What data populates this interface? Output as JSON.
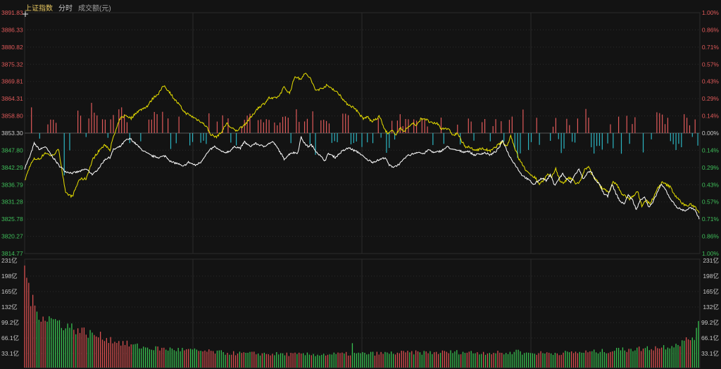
{
  "header": {
    "index_name": "上证指数",
    "view_mode": "分时",
    "volume_label": "成交额(元)"
  },
  "colors": {
    "background": "#131313",
    "grid": "#2b2b2b",
    "up": "#e05a5a",
    "down": "#2cb5c2",
    "price_line": "#ffffff",
    "avg_line": "#e8e000",
    "vol_up": "#d85050",
    "vol_down": "#38c050",
    "label_text": "#c8c8c8"
  },
  "chart_data": [
    {
      "type": "line",
      "ylim": [
        3814.77,
        3891.83
      ],
      "base": 3853.3,
      "y_ticks_left": [
        "3891.83",
        "3886.33",
        "3880.82",
        "3875.32",
        "3869.81",
        "3864.31",
        "3858.80",
        "3853.30",
        "3847.80",
        "3842.29",
        "3836.79",
        "3831.28",
        "3825.78",
        "3820.27",
        "3814.77"
      ],
      "y_ticks_right": [
        "1.00%",
        "0.86%",
        "0.71%",
        "0.57%",
        "0.43%",
        "0.29%",
        "0.14%",
        "0.00%",
        "0.14%",
        "0.29%",
        "0.43%",
        "0.57%",
        "0.71%",
        "0.86%",
        "1.00%"
      ],
      "price_keypoints": [
        [
          0,
          3842
        ],
        [
          8,
          3846
        ],
        [
          14,
          3850
        ],
        [
          22,
          3848
        ],
        [
          30,
          3849
        ],
        [
          40,
          3846
        ],
        [
          50,
          3843
        ],
        [
          60,
          3841
        ],
        [
          70,
          3840.5
        ],
        [
          80,
          3841
        ],
        [
          90,
          3841.8
        ],
        [
          100,
          3840
        ],
        [
          110,
          3842.5
        ],
        [
          118,
          3845
        ],
        [
          125,
          3845.5
        ],
        [
          130,
          3848
        ],
        [
          140,
          3849
        ],
        [
          148,
          3851
        ],
        [
          155,
          3851.5
        ],
        [
          162,
          3850
        ],
        [
          170,
          3848.3
        ],
        [
          178,
          3847
        ],
        [
          186,
          3846
        ],
        [
          196,
          3845.5
        ],
        [
          206,
          3846
        ],
        [
          215,
          3844
        ],
        [
          225,
          3843.5
        ],
        [
          232,
          3842.5
        ],
        [
          240,
          3844
        ],
        [
          250,
          3843
        ],
        [
          258,
          3844
        ],
        [
          264,
          3846
        ],
        [
          272,
          3848
        ],
        [
          278,
          3849
        ],
        [
          284,
          3848
        ],
        [
          292,
          3847
        ],
        [
          300,
          3847.5
        ],
        [
          308,
          3849
        ],
        [
          316,
          3848.5
        ],
        [
          322,
          3850.5
        ],
        [
          330,
          3849
        ],
        [
          338,
          3850
        ],
        [
          344,
          3849.5
        ],
        [
          350,
          3849
        ],
        [
          358,
          3850
        ],
        [
          364,
          3850.5
        ],
        [
          372,
          3848
        ],
        [
          380,
          3845
        ],
        [
          390,
          3847
        ],
        [
          400,
          3847
        ],
        [
          405,
          3852
        ],
        [
          410,
          3850
        ],
        [
          415,
          3849
        ],
        [
          420,
          3849.5
        ],
        [
          425,
          3848
        ],
        [
          435,
          3845.5
        ],
        [
          440,
          3844.5
        ],
        [
          445,
          3846.8
        ],
        [
          455,
          3845.5
        ],
        [
          465,
          3847.5
        ],
        [
          475,
          3848.6
        ],
        [
          482,
          3847.8
        ],
        [
          490,
          3847
        ],
        [
          500,
          3845
        ],
        [
          510,
          3844
        ],
        [
          520,
          3844.8
        ],
        [
          528,
          3845.5
        ],
        [
          534,
          3843
        ],
        [
          540,
          3842.5
        ],
        [
          546,
          3843
        ],
        [
          552,
          3844
        ],
        [
          560,
          3846
        ],
        [
          568,
          3846.6
        ],
        [
          576,
          3847.3
        ],
        [
          584,
          3846.6
        ],
        [
          592,
          3848
        ],
        [
          600,
          3847
        ],
        [
          610,
          3847.6
        ],
        [
          620,
          3849
        ],
        [
          626,
          3848
        ],
        [
          634,
          3847.8
        ],
        [
          642,
          3847.3
        ],
        [
          650,
          3847.5
        ],
        [
          658,
          3846.3
        ],
        [
          666,
          3846.6
        ],
        [
          674,
          3847
        ],
        [
          682,
          3846.3
        ],
        [
          690,
          3847.4
        ],
        [
          696,
          3849
        ],
        [
          700,
          3851
        ],
        [
          704,
          3849
        ],
        [
          710,
          3846
        ],
        [
          716,
          3844
        ],
        [
          722,
          3842
        ],
        [
          728,
          3840
        ],
        [
          734,
          3839
        ],
        [
          740,
          3838
        ],
        [
          746,
          3836.8
        ],
        [
          752,
          3838
        ],
        [
          758,
          3839
        ],
        [
          764,
          3838
        ],
        [
          770,
          3840
        ],
        [
          776,
          3836.6
        ],
        [
          782,
          3838.5
        ],
        [
          788,
          3840.3
        ],
        [
          794,
          3838.5
        ],
        [
          800,
          3837.5
        ],
        [
          806,
          3840
        ],
        [
          812,
          3841.8
        ],
        [
          818,
          3838.5
        ],
        [
          824,
          3840.6
        ],
        [
          830,
          3841
        ],
        [
          836,
          3838
        ],
        [
          842,
          3837
        ],
        [
          848,
          3834
        ],
        [
          854,
          3833
        ],
        [
          860,
          3837
        ],
        [
          866,
          3834
        ],
        [
          872,
          3831.5
        ],
        [
          878,
          3830.6
        ],
        [
          884,
          3833.5
        ],
        [
          890,
          3832
        ],
        [
          896,
          3828.8
        ],
        [
          902,
          3832
        ],
        [
          908,
          3833
        ],
        [
          914,
          3829.5
        ],
        [
          920,
          3831
        ],
        [
          926,
          3834
        ],
        [
          932,
          3836.8
        ],
        [
          938,
          3835.5
        ],
        [
          944,
          3833
        ],
        [
          950,
          3831
        ],
        [
          956,
          3829.5
        ],
        [
          962,
          3828.8
        ],
        [
          968,
          3828.5
        ],
        [
          975,
          3829.5
        ],
        [
          982,
          3828.5
        ],
        [
          988,
          3826
        ]
      ],
      "avg_keypoints": [
        [
          0,
          3838
        ],
        [
          8,
          3843
        ],
        [
          14,
          3845
        ],
        [
          22,
          3845
        ],
        [
          30,
          3847
        ],
        [
          40,
          3846
        ],
        [
          50,
          3848
        ],
        [
          60,
          3834
        ],
        [
          70,
          3833
        ],
        [
          80,
          3838.5
        ],
        [
          90,
          3838.7
        ],
        [
          100,
          3845
        ],
        [
          110,
          3848
        ],
        [
          118,
          3849.5
        ],
        [
          125,
          3848
        ],
        [
          130,
          3852
        ],
        [
          140,
          3858
        ],
        [
          148,
          3859
        ],
        [
          156,
          3858
        ],
        [
          164,
          3860
        ],
        [
          172,
          3861
        ],
        [
          180,
          3862
        ],
        [
          188,
          3864.5
        ],
        [
          196,
          3866
        ],
        [
          204,
          3868.5
        ],
        [
          212,
          3866.5
        ],
        [
          220,
          3864
        ],
        [
          226,
          3862.5
        ],
        [
          234,
          3860
        ],
        [
          242,
          3859
        ],
        [
          250,
          3858
        ],
        [
          258,
          3857
        ],
        [
          266,
          3855.5
        ],
        [
          272,
          3853
        ],
        [
          280,
          3852
        ],
        [
          288,
          3853.5
        ],
        [
          296,
          3856.5
        ],
        [
          302,
          3855
        ],
        [
          310,
          3854
        ],
        [
          316,
          3855
        ],
        [
          322,
          3856
        ],
        [
          328,
          3857.5
        ],
        [
          334,
          3859
        ],
        [
          340,
          3861
        ],
        [
          346,
          3862
        ],
        [
          352,
          3863
        ],
        [
          358,
          3864.6
        ],
        [
          364,
          3864.3
        ],
        [
          372,
          3865
        ],
        [
          380,
          3868
        ],
        [
          388,
          3866
        ],
        [
          396,
          3871.5
        ],
        [
          404,
          3870.5
        ],
        [
          410,
          3872.5
        ],
        [
          418,
          3871
        ],
        [
          426,
          3867
        ],
        [
          434,
          3867.5
        ],
        [
          442,
          3868.5
        ],
        [
          450,
          3867.7
        ],
        [
          456,
          3866.6
        ],
        [
          462,
          3865.5
        ],
        [
          470,
          3863
        ],
        [
          478,
          3862
        ],
        [
          484,
          3861.2
        ],
        [
          490,
          3859.5
        ],
        [
          496,
          3857.8
        ],
        [
          502,
          3858.6
        ],
        [
          508,
          3857
        ],
        [
          514,
          3857.6
        ],
        [
          520,
          3858.7
        ],
        [
          526,
          3855
        ],
        [
          532,
          3853
        ],
        [
          538,
          3854
        ],
        [
          544,
          3853
        ],
        [
          550,
          3854.8
        ],
        [
          556,
          3854
        ],
        [
          562,
          3855.2
        ],
        [
          568,
          3856.5
        ],
        [
          574,
          3855.6
        ],
        [
          580,
          3857.8
        ],
        [
          586,
          3858
        ],
        [
          592,
          3857
        ],
        [
          598,
          3856.3
        ],
        [
          604,
          3856.5
        ],
        [
          610,
          3854.7
        ],
        [
          616,
          3855
        ],
        [
          622,
          3854.2
        ],
        [
          628,
          3852.5
        ],
        [
          634,
          3853.3
        ],
        [
          640,
          3850.6
        ],
        [
          646,
          3849
        ],
        [
          652,
          3848.7
        ],
        [
          658,
          3847.8
        ],
        [
          664,
          3848.1
        ],
        [
          670,
          3848.3
        ],
        [
          676,
          3848
        ],
        [
          682,
          3847.5
        ],
        [
          688,
          3848.5
        ],
        [
          694,
          3849.6
        ],
        [
          700,
          3850.5
        ],
        [
          706,
          3849
        ],
        [
          712,
          3852.5
        ],
        [
          718,
          3848.5
        ],
        [
          724,
          3845
        ],
        [
          730,
          3843
        ],
        [
          736,
          3840.7
        ],
        [
          742,
          3840
        ],
        [
          748,
          3839
        ],
        [
          754,
          3837
        ],
        [
          760,
          3838.3
        ],
        [
          766,
          3840
        ],
        [
          772,
          3839.2
        ],
        [
          778,
          3842
        ],
        [
          784,
          3838
        ],
        [
          790,
          3837.3
        ],
        [
          796,
          3839
        ],
        [
          802,
          3838.5
        ],
        [
          808,
          3837
        ],
        [
          814,
          3837.8
        ],
        [
          820,
          3841.5
        ],
        [
          826,
          3842.5
        ],
        [
          832,
          3839.5
        ],
        [
          838,
          3838.3
        ],
        [
          844,
          3836
        ],
        [
          850,
          3835.4
        ],
        [
          856,
          3834
        ],
        [
          862,
          3837.6
        ],
        [
          868,
          3836.6
        ],
        [
          874,
          3834
        ],
        [
          880,
          3833.2
        ],
        [
          886,
          3832
        ],
        [
          892,
          3833.5
        ],
        [
          898,
          3834.5
        ],
        [
          904,
          3830
        ],
        [
          910,
          3831.8
        ],
        [
          916,
          3830.8
        ],
        [
          922,
          3833
        ],
        [
          928,
          3836
        ],
        [
          934,
          3837.5
        ],
        [
          940,
          3836.8
        ],
        [
          946,
          3836
        ],
        [
          952,
          3833.6
        ],
        [
          958,
          3832
        ],
        [
          964,
          3830.7
        ],
        [
          970,
          3830
        ],
        [
          976,
          3830.4
        ],
        [
          982,
          3829.7
        ],
        [
          988,
          3828
        ]
      ],
      "series": [
        {
          "key": "price_keypoints",
          "color": "#ffffff"
        },
        {
          "key": "avg_keypoints",
          "color": "#e8e000"
        }
      ]
    },
    {
      "type": "bar",
      "y_ticks": [
        "231亿",
        "198亿",
        "165亿",
        "132亿",
        "99.2亿",
        "66.1亿",
        "33.1亿"
      ],
      "ylim": [
        0,
        231
      ],
      "volume_keypoints": [
        [
          0,
          231
        ],
        [
          3,
          190
        ],
        [
          6,
          170
        ],
        [
          9,
          150
        ],
        [
          12,
          135
        ],
        [
          15,
          125
        ],
        [
          20,
          118
        ],
        [
          30,
          108
        ],
        [
          40,
          103
        ],
        [
          50,
          97
        ],
        [
          60,
          90
        ],
        [
          70,
          85
        ],
        [
          80,
          80
        ],
        [
          90,
          75
        ],
        [
          100,
          70
        ],
        [
          110,
          67
        ],
        [
          120,
          63
        ],
        [
          130,
          58
        ],
        [
          140,
          54
        ],
        [
          150,
          50
        ],
        [
          160,
          47
        ],
        [
          170,
          44
        ],
        [
          180,
          42
        ],
        [
          200,
          40
        ],
        [
          220,
          39
        ],
        [
          240,
          37
        ],
        [
          260,
          35
        ],
        [
          280,
          33
        ],
        [
          300,
          31
        ],
        [
          320,
          30
        ],
        [
          340,
          30
        ],
        [
          360,
          29
        ],
        [
          380,
          29
        ],
        [
          400,
          28
        ],
        [
          420,
          28
        ],
        [
          440,
          28
        ],
        [
          460,
          29
        ],
        [
          480,
          29
        ],
        [
          500,
          30
        ],
        [
          520,
          30
        ],
        [
          540,
          31
        ],
        [
          560,
          32
        ],
        [
          580,
          32
        ],
        [
          600,
          32
        ],
        [
          620,
          33
        ],
        [
          640,
          33
        ],
        [
          660,
          32
        ],
        [
          680,
          32
        ],
        [
          700,
          31
        ],
        [
          720,
          31
        ],
        [
          740,
          31
        ],
        [
          760,
          31
        ],
        [
          780,
          31
        ],
        [
          800,
          32
        ],
        [
          820,
          33
        ],
        [
          840,
          34
        ],
        [
          860,
          36
        ],
        [
          880,
          38
        ],
        [
          900,
          40
        ],
        [
          920,
          42
        ],
        [
          940,
          45
        ],
        [
          955,
          50
        ],
        [
          965,
          55
        ],
        [
          975,
          62
        ],
        [
          982,
          70
        ],
        [
          986,
          80
        ],
        [
          989,
          99
        ]
      ],
      "volume_spikes": [
        [
          480,
          52
        ],
        [
          722,
          38
        ],
        [
          868,
          42
        ],
        [
          886,
          40
        ]
      ]
    }
  ]
}
